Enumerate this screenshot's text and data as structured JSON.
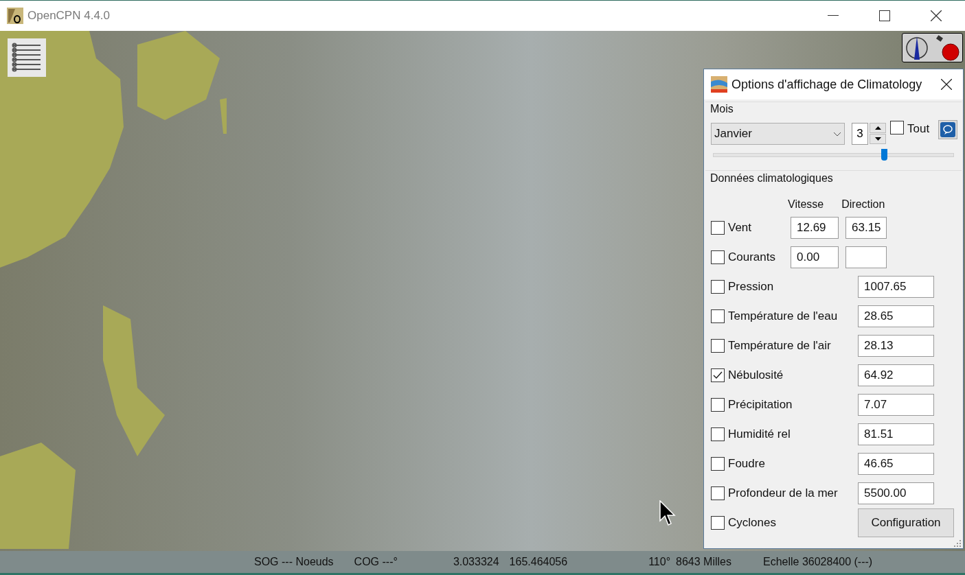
{
  "window": {
    "title": "OpenCPN 4.4.0"
  },
  "dialog": {
    "title": "Options d'affichage de Climatology",
    "month_group": {
      "label": "Mois",
      "month": "Janvier",
      "spin_value": "3",
      "all": {
        "label": "Tout",
        "checked": false
      },
      "slider": {
        "level": 0.71
      }
    },
    "data_group": {
      "label": "Données climatologiques",
      "headers": [
        "Vitesse",
        "Direction"
      ],
      "rows": [
        {
          "kind": "pair",
          "label": "Vent",
          "checked": false,
          "values": [
            "12.69",
            "63.15"
          ]
        },
        {
          "kind": "pair",
          "label": "Courants",
          "checked": false,
          "values": [
            "0.00"
          ]
        },
        {
          "kind": "single",
          "label": "Pression",
          "checked": false,
          "value": "1007.65"
        },
        {
          "kind": "single",
          "label": "Température de l'eau",
          "checked": false,
          "value": "28.65"
        },
        {
          "kind": "single",
          "label": "Température de l'air",
          "checked": false,
          "value": "28.13"
        },
        {
          "kind": "single",
          "label": "Nébulosité",
          "checked": true,
          "value": "64.92"
        },
        {
          "kind": "single",
          "label": "Précipitation",
          "checked": false,
          "value": "7.07"
        },
        {
          "kind": "single",
          "label": "Humidité rel",
          "checked": false,
          "value": "81.51"
        },
        {
          "kind": "single",
          "label": "Foudre",
          "checked": false,
          "value": "46.65"
        },
        {
          "kind": "single",
          "label": "Profondeur de la mer",
          "checked": false,
          "value": "5500.00"
        },
        {
          "kind": "button",
          "label": "Cyclones",
          "checked": false,
          "button": "Configuration"
        }
      ]
    }
  },
  "status_bar": {
    "sog": "SOG --- Noeuds",
    "cog": "COG ---°",
    "lat": "3.033324",
    "lon": "165.464056",
    "bearing": "110°",
    "distance": "8643 Milles",
    "scale": "Echelle 36028400 (---)"
  }
}
